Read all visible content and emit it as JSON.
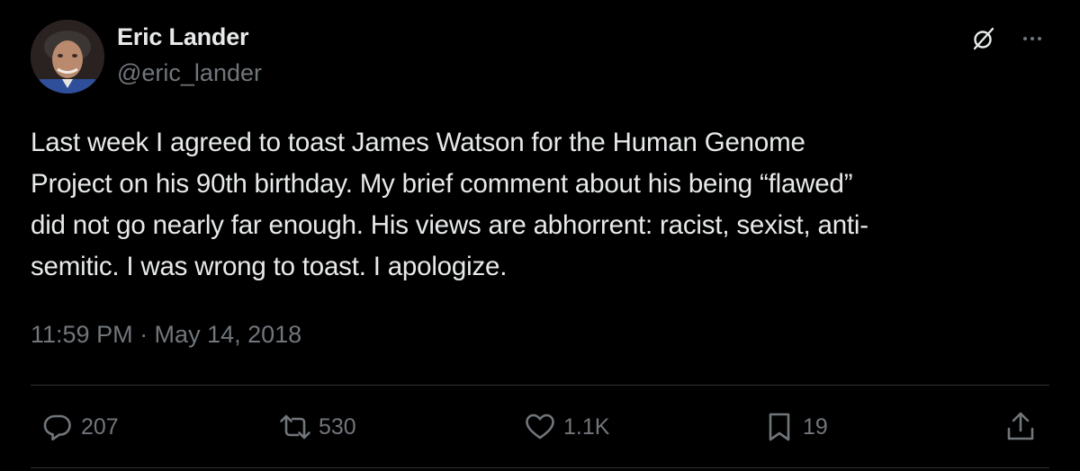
{
  "author": {
    "name": "Eric Lander",
    "handle": "@eric_lander"
  },
  "tweet": {
    "text": "Last week I agreed to toast James Watson for the Human Genome\nProject on his 90th birthday. My brief comment about his being “flawed”\ndid not go nearly far enough. His views are abhorrent: racist, sexist, anti-\nsemitic. I was wrong to toast. I apologize.",
    "timestamp": "11:59 PM · May 14, 2018"
  },
  "actions": {
    "replies": "207",
    "reposts": "530",
    "likes": "1.1K",
    "bookmarks": "19"
  },
  "icons": {
    "grok": "grok-icon",
    "more": "more-icon",
    "reply": "reply-icon",
    "repost": "repost-icon",
    "like": "heart-icon",
    "bookmark": "bookmark-icon",
    "share": "share-icon"
  },
  "colors": {
    "background": "#000000",
    "primary_text": "#e7e9ea",
    "secondary_text": "#71767b",
    "divider": "#2f3336"
  }
}
